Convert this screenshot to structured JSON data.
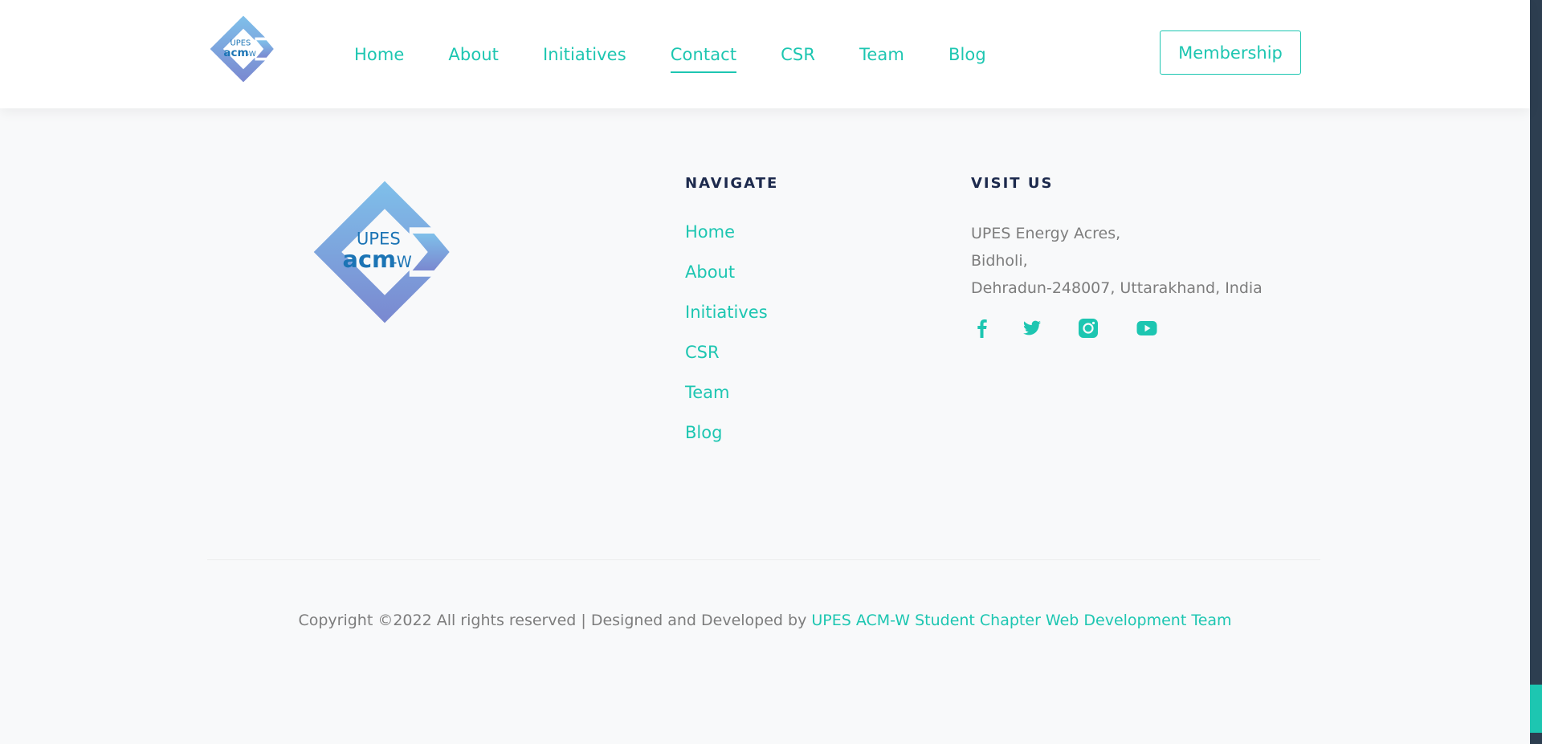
{
  "brand": {
    "logo_line1": "UPES",
    "logo_line2": "acm",
    "logo_suffix": "-W",
    "accent_color": "#1dc6b1",
    "heading_color": "#1d2a4d",
    "text_color": "#7d7d7d"
  },
  "header": {
    "nav": [
      {
        "label": "Home",
        "active": false
      },
      {
        "label": "About",
        "active": false
      },
      {
        "label": "Initiatives",
        "active": false
      },
      {
        "label": "Contact",
        "active": true
      },
      {
        "label": "CSR",
        "active": false
      },
      {
        "label": "Team",
        "active": false
      },
      {
        "label": "Blog",
        "active": false
      }
    ],
    "membership_label": "Membership"
  },
  "footer": {
    "navigate_title": "NAVIGATE",
    "navigate_links": [
      "Home",
      "About",
      "Initiatives",
      "CSR",
      "Team",
      "Blog"
    ],
    "visit_title": "VISIT US",
    "address_lines": [
      "UPES Energy Acres,",
      "Bidholi,",
      "Dehradun-248007, Uttarakhand, India"
    ],
    "socials": [
      {
        "icon": "facebook-icon"
      },
      {
        "icon": "twitter-icon"
      },
      {
        "icon": "instagram-icon"
      },
      {
        "icon": "youtube-icon"
      }
    ],
    "copyright_text": "Copyright ©2022 All rights reserved | Designed and Developed by ",
    "credit_link": "UPES ACM-W Student Chapter Web Development Team"
  }
}
